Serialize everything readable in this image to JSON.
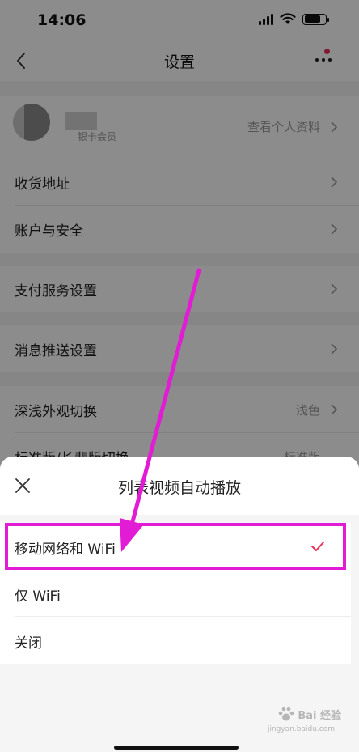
{
  "status_bar": {
    "time": "14:06"
  },
  "nav": {
    "title": "设置"
  },
  "profile": {
    "member_label": "银卡会员",
    "link_label": "查看个人资料"
  },
  "settings_rows": [
    {
      "label": "收货地址",
      "value": ""
    },
    {
      "label": "账户与安全",
      "value": ""
    },
    {
      "label": "支付服务设置",
      "value": ""
    },
    {
      "label": "消息推送设置",
      "value": ""
    },
    {
      "label": "深浅外观切换",
      "value": "浅色"
    },
    {
      "label": "标准版/长辈版切换",
      "value": "标准版"
    }
  ],
  "sheet": {
    "title": "列表视频自动播放",
    "options": [
      {
        "label": "移动网络和 WiFi",
        "selected": true
      },
      {
        "label": "仅 WiFi",
        "selected": false
      },
      {
        "label": "关闭",
        "selected": false
      }
    ]
  },
  "watermark": {
    "text": "Bai 经验",
    "sub": "jingyan.baidu.com"
  },
  "colors": {
    "highlight": "#e11cd4",
    "check": "#e8325a",
    "badge": "#e8325a"
  }
}
